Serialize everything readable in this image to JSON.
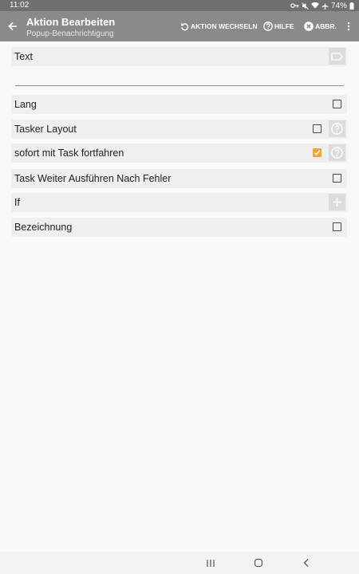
{
  "status_bar": {
    "time": "11:02",
    "battery": "74%",
    "icons": [
      "key-icon",
      "mute-icon",
      "wifi-icon",
      "airplane-icon",
      "battery-icon"
    ]
  },
  "app_bar": {
    "title": "Aktion Bearbeiten",
    "subtitle": "Popup-Benachrichtigung",
    "actions": {
      "switch_action": "AKTION WECHSELN",
      "help": "HILFE",
      "cancel": "ABBR."
    }
  },
  "fields": {
    "text": {
      "label": "Text",
      "value": ""
    },
    "lang": {
      "label": "Lang",
      "checked": false
    },
    "tasker_layout": {
      "label": "Tasker Layout",
      "checked": false
    },
    "continue_immediately": {
      "label": "sofort mit Task fortfahren",
      "checked": true
    },
    "continue_after_error": {
      "label": "Task Weiter Ausführen Nach Fehler",
      "checked": false
    },
    "if": {
      "label": "If"
    },
    "label_field": {
      "label": "Bezeichnung",
      "checked": false
    }
  },
  "colors": {
    "status_bar": "#6f6f6f",
    "app_bar": "#8a8a8a",
    "checkbox_accent": "#f0a833",
    "row_background": "#efefef",
    "page_background": "#f9f9f9"
  }
}
